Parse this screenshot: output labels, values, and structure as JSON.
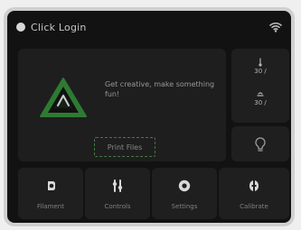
{
  "app": {
    "title": "Click Login",
    "status_icons": {
      "wifi": "wifi-icon",
      "user": "user-dot-icon"
    }
  },
  "main": {
    "message": "Get creative, make something fun!",
    "print_label": "Print Files",
    "logo_icon": "alert-triangle-logo"
  },
  "right_panel": {
    "nozzle": {
      "icon": "nozzle-temp-icon",
      "value": "30 /"
    },
    "bed": {
      "icon": "bed-temp-icon",
      "value": "30 /"
    },
    "light_icon": "light-bulb-icon"
  },
  "bottom_buttons": [
    {
      "label": "Filament",
      "icon": "filament-icon"
    },
    {
      "label": "Controls",
      "icon": "controls-icon"
    },
    {
      "label": "Settings",
      "icon": "settings-icon"
    },
    {
      "label": "Calibrate",
      "icon": "calibrate-icon"
    }
  ],
  "colors": {
    "background": "#121212",
    "card": "#1f1f1f",
    "accent_green": "#2f7a33"
  }
}
